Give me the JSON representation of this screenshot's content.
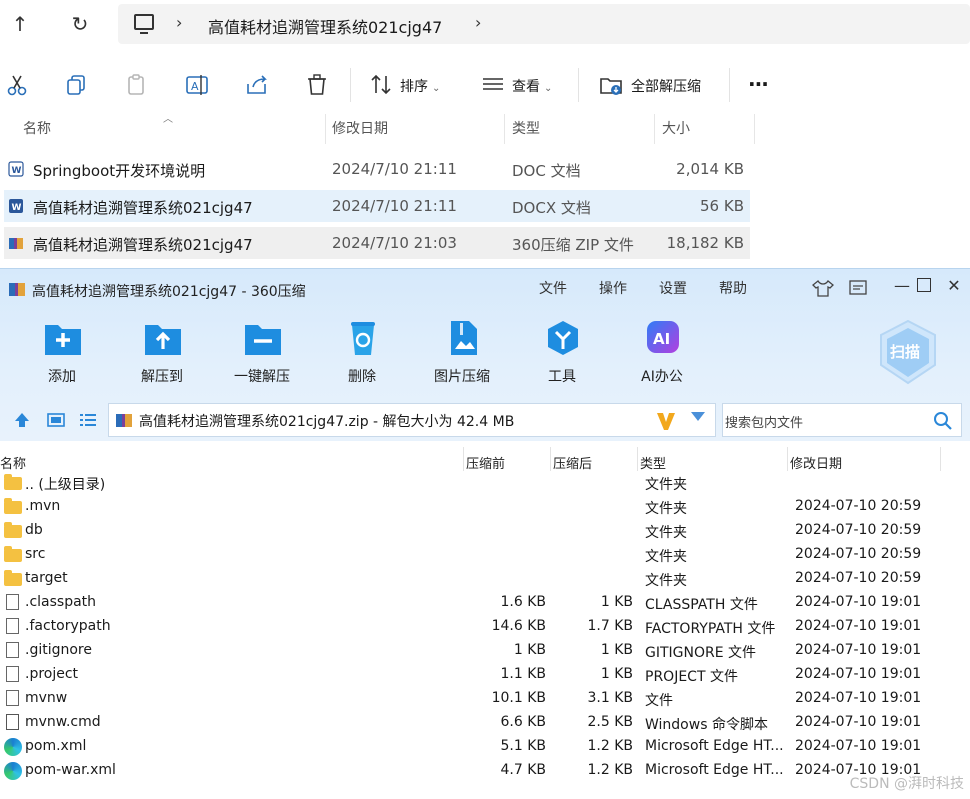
{
  "explorer": {
    "address": {
      "path": "高值耗材追溯管理系统021cjg47"
    },
    "toolbar": {
      "sort_label": "排序",
      "view_label": "查看",
      "extract_all_label": "全部解压缩",
      "more_label": "···"
    },
    "columns": [
      "名称",
      "修改日期",
      "类型",
      "大小"
    ],
    "files": [
      {
        "name": "Springboot开发环境说明",
        "date": "2024/7/10 21:11",
        "type": "DOC 文档",
        "size": "2,014 KB",
        "icon": "word-icon"
      },
      {
        "name": "高值耗材追溯管理系统021cjg47",
        "date": "2024/7/10 21:11",
        "type": "DOCX 文档",
        "size": "56 KB",
        "icon": "word-icon"
      },
      {
        "name": "高值耗材追溯管理系统021cjg47",
        "date": "2024/7/10 21:03",
        "type": "360压缩 ZIP 文件",
        "size": "18,182 KB",
        "icon": "zip-icon"
      }
    ]
  },
  "zip": {
    "title": "高值耗材追溯管理系统021cjg47 - 360压缩",
    "menu": [
      "文件",
      "操作",
      "设置",
      "帮助"
    ],
    "tools": [
      "添加",
      "解压到",
      "一键解压",
      "删除",
      "图片压缩",
      "工具",
      "AI办公"
    ],
    "scan_label": "扫描",
    "path_text": "高值耗材追溯管理系统021cjg47.zip - 解包大小为 42.4 MB",
    "search_placeholder": "搜索包内文件",
    "columns": {
      "name": "名称",
      "before": "压缩前",
      "after": "压缩后",
      "type": "类型",
      "date": "修改日期"
    },
    "rows": [
      {
        "name": ".. (上级目录)",
        "before": "",
        "after": "",
        "type": "文件夹",
        "date": "",
        "icon": "folder-icon"
      },
      {
        "name": ".mvn",
        "before": "",
        "after": "",
        "type": "文件夹",
        "date": "2024-07-10 20:59",
        "icon": "folder-icon"
      },
      {
        "name": "db",
        "before": "",
        "after": "",
        "type": "文件夹",
        "date": "2024-07-10 20:59",
        "icon": "folder-icon"
      },
      {
        "name": "src",
        "before": "",
        "after": "",
        "type": "文件夹",
        "date": "2024-07-10 20:59",
        "icon": "folder-icon"
      },
      {
        "name": "target",
        "before": "",
        "after": "",
        "type": "文件夹",
        "date": "2024-07-10 20:59",
        "icon": "folder-icon"
      },
      {
        "name": ".classpath",
        "before": "1.6 KB",
        "after": "1 KB",
        "type": "CLASSPATH 文件",
        "date": "2024-07-10 19:01",
        "icon": "file-icon"
      },
      {
        "name": ".factorypath",
        "before": "14.6 KB",
        "after": "1.7 KB",
        "type": "FACTORYPATH 文件",
        "date": "2024-07-10 19:01",
        "icon": "file-icon"
      },
      {
        "name": ".gitignore",
        "before": "1 KB",
        "after": "1 KB",
        "type": "GITIGNORE 文件",
        "date": "2024-07-10 19:01",
        "icon": "file-icon"
      },
      {
        "name": ".project",
        "before": "1.1 KB",
        "after": "1 KB",
        "type": "PROJECT 文件",
        "date": "2024-07-10 19:01",
        "icon": "file-icon"
      },
      {
        "name": "mvnw",
        "before": "10.1 KB",
        "after": "3.1 KB",
        "type": "文件",
        "date": "2024-07-10 19:01",
        "icon": "file-icon"
      },
      {
        "name": "mvnw.cmd",
        "before": "6.6 KB",
        "after": "2.5 KB",
        "type": "Windows 命令脚本",
        "date": "2024-07-10 19:01",
        "icon": "cmd-icon"
      },
      {
        "name": "pom.xml",
        "before": "5.1 KB",
        "after": "1.2 KB",
        "type": "Microsoft Edge HT...",
        "date": "2024-07-10 19:01",
        "icon": "edge-icon"
      },
      {
        "name": "pom-war.xml",
        "before": "4.7 KB",
        "after": "1.2 KB",
        "type": "Microsoft Edge HT...",
        "date": "2024-07-10 19:01",
        "icon": "edge-icon"
      }
    ]
  },
  "watermark": "CSDN @湃时科技"
}
